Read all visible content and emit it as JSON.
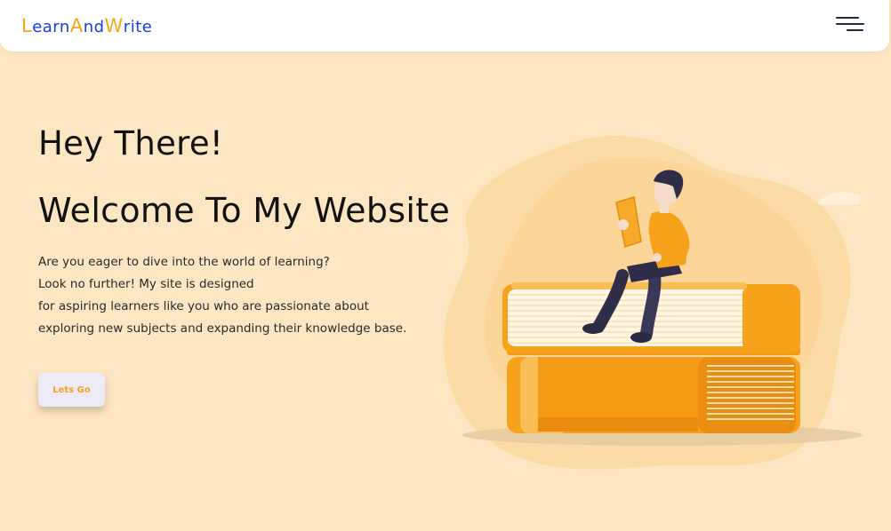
{
  "nav": {
    "logo_parts": [
      "L",
      "earn",
      "A",
      "nd",
      "W",
      "rite"
    ],
    "menu_icon": "hamburger-menu-icon"
  },
  "hero": {
    "title_1": "Hey There!",
    "title_2": "Welcome To My Website",
    "description_lines": [
      "Are you eager to dive into the world of learning?",
      "Look no further! My site is designed",
      "for aspiring learners like you who are passionate about",
      "exploring new subjects and expanding their knowledge base."
    ],
    "cta_label": "Lets Go"
  },
  "colors": {
    "background": "#fde6c2",
    "accent_orange": "#f7a21b",
    "logo_blue": "#1a3de0",
    "text_dark": "#121212"
  }
}
